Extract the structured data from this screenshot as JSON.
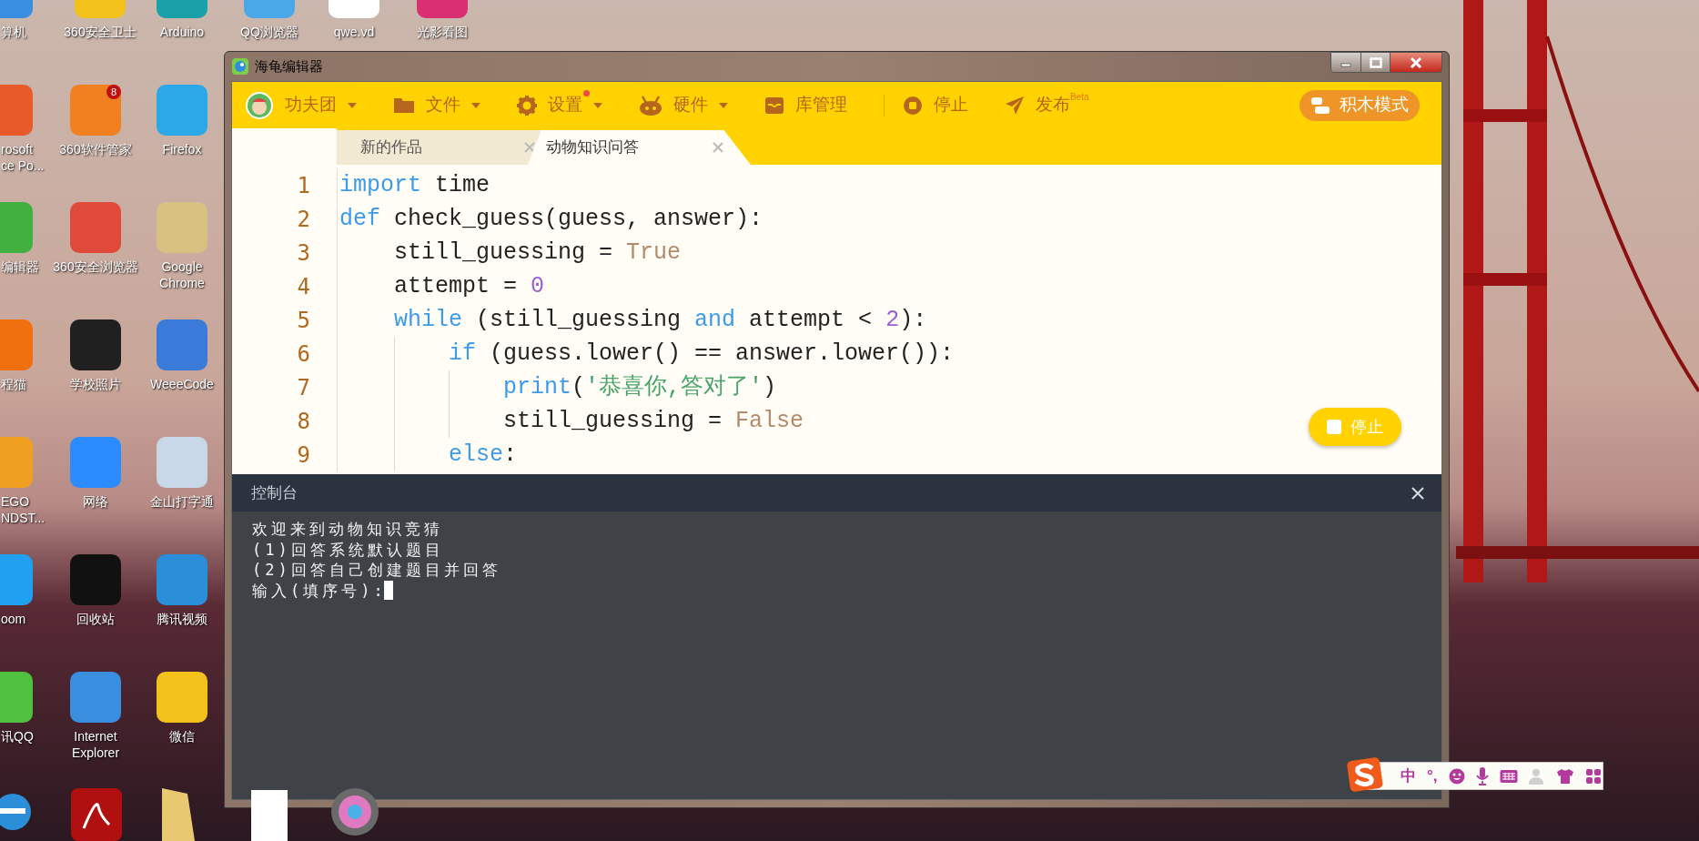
{
  "desktop": {
    "rows": [
      [
        {
          "label": "算机"
        },
        {
          "label": "360安全卫士"
        },
        {
          "label": "Arduino"
        },
        {
          "label": "QQ浏览器"
        },
        {
          "label": "qwe.vd"
        },
        {
          "label": "光影看图"
        }
      ],
      [
        {
          "label": "rosoft\nce Po..."
        },
        {
          "label": "360软件管家",
          "badge": "8"
        },
        {
          "label": "Firefox"
        }
      ],
      [
        {
          "label": "编辑器"
        },
        {
          "label": "360安全浏览器"
        },
        {
          "label": "Google\nChrome"
        }
      ],
      [
        {
          "label": "程猫"
        },
        {
          "label": "学校照片"
        },
        {
          "label": "WeeeCode"
        }
      ],
      [
        {
          "label": "EGO\nNDST..."
        },
        {
          "label": "网络"
        },
        {
          "label": "金山打字通"
        }
      ],
      [
        {
          "label": "oom"
        },
        {
          "label": "回收站"
        },
        {
          "label": "腾讯视频"
        }
      ],
      [
        {
          "label": "讯QQ"
        },
        {
          "label": "Internet\nExplorer"
        },
        {
          "label": "微信"
        }
      ]
    ]
  },
  "window": {
    "title": "海龟编辑器"
  },
  "toolbar": {
    "items": [
      {
        "label": "功夫团",
        "dropdown": true,
        "notification": false
      },
      {
        "label": "文件",
        "dropdown": true,
        "notification": false
      },
      {
        "label": "设置",
        "dropdown": true,
        "notification": true
      },
      {
        "label": "硬件",
        "dropdown": true,
        "notification": false
      },
      {
        "label": "库管理",
        "dropdown": false,
        "notification": false
      },
      {
        "label": "停止",
        "dropdown": false,
        "notification": false
      },
      {
        "label": "发布",
        "superscript": "Beta",
        "dropdown": false,
        "notification": false
      }
    ],
    "mode_button": "积木模式"
  },
  "tabs": [
    {
      "label": "新的作品",
      "selected": false
    },
    {
      "label": "动物知识问答",
      "selected": true
    }
  ],
  "editor": {
    "lines": [
      {
        "number": "1",
        "tokens": [
          {
            "kind": "keyword",
            "text": "import"
          },
          {
            "kind": "plain",
            "text": " time"
          }
        ]
      },
      {
        "number": "2",
        "tokens": [
          {
            "kind": "keyword",
            "text": "def"
          },
          {
            "kind": "plain",
            "text": " check_guess(guess, answer):"
          }
        ]
      },
      {
        "number": "3",
        "tokens": [
          {
            "kind": "plain",
            "text": "    still_guessing = "
          },
          {
            "kind": "constant",
            "text": "True"
          }
        ]
      },
      {
        "number": "4",
        "tokens": [
          {
            "kind": "plain",
            "text": "    attempt = "
          },
          {
            "kind": "number",
            "text": "0"
          }
        ]
      },
      {
        "number": "5",
        "tokens": [
          {
            "kind": "keyword",
            "text": "    while"
          },
          {
            "kind": "plain",
            "text": " (still_guessing "
          },
          {
            "kind": "keyword",
            "text": "and"
          },
          {
            "kind": "plain",
            "text": " attempt < "
          },
          {
            "kind": "number",
            "text": "2"
          },
          {
            "kind": "plain",
            "text": "):"
          }
        ]
      },
      {
        "number": "6",
        "tokens": [
          {
            "kind": "keyword",
            "text": "        if"
          },
          {
            "kind": "plain",
            "text": " (guess.lower() == answer.lower()):"
          }
        ]
      },
      {
        "number": "7",
        "tokens": [
          {
            "kind": "keyword",
            "text": "            print"
          },
          {
            "kind": "plain",
            "text": "("
          },
          {
            "kind": "string",
            "text": "'恭喜你,答对了'"
          },
          {
            "kind": "plain",
            "text": ")"
          }
        ]
      },
      {
        "number": "8",
        "tokens": [
          {
            "kind": "plain",
            "text": "            still_guessing = "
          },
          {
            "kind": "constant",
            "text": "False"
          }
        ]
      },
      {
        "number": "9",
        "tokens": [
          {
            "kind": "keyword",
            "text": "        else"
          },
          {
            "kind": "plain",
            "text": ":"
          }
        ]
      }
    ]
  },
  "run_button": {
    "label": "停止"
  },
  "console": {
    "title": "控制台",
    "lines": [
      "欢迎来到动物知识竞猜",
      "(1)回答系统默认题目",
      "(2)回答自己创建题目并回答"
    ],
    "prompt": "输入(填序号):"
  },
  "ime_toolbar": {
    "mode": "中",
    "punctuation": "°,"
  }
}
